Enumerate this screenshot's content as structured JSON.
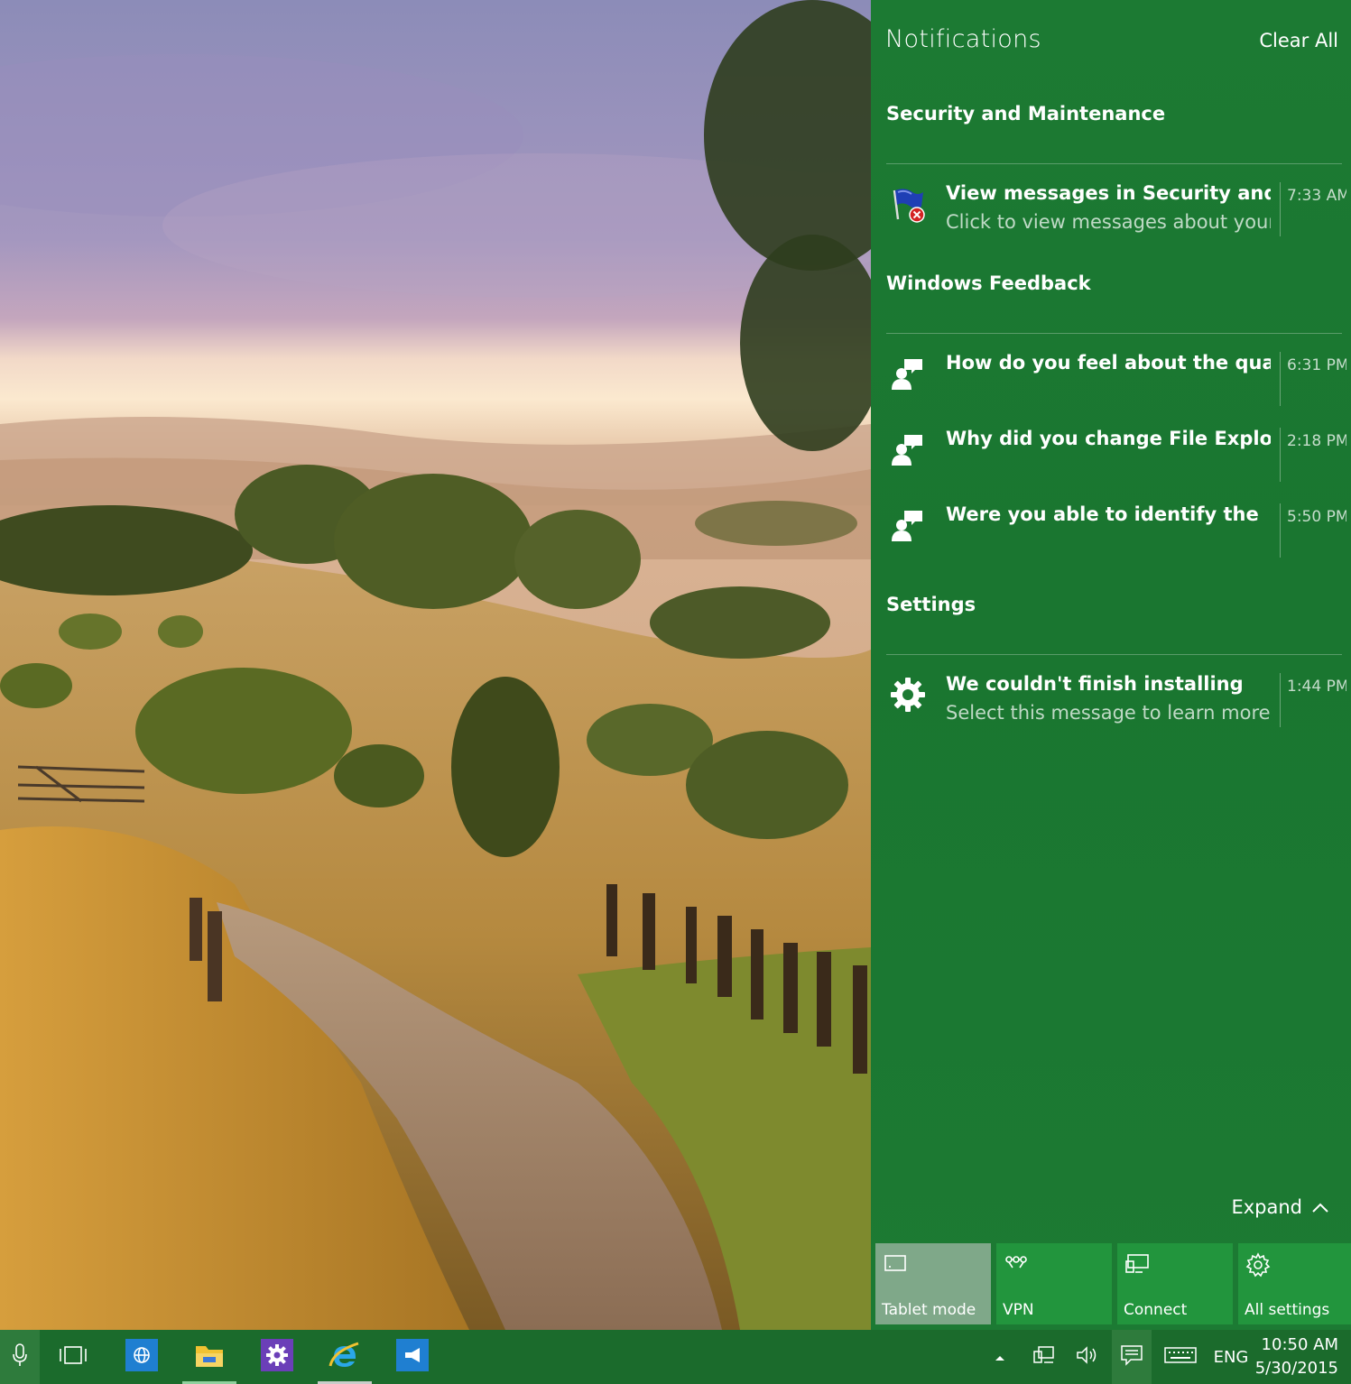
{
  "action_center": {
    "title": "Notifications",
    "clear_all": "Clear All",
    "groups": [
      {
        "title": "Security and Maintenance",
        "notifications": [
          {
            "title": "View messages in Security and",
            "body": "Click to view messages about your",
            "time": "7:33 AM",
            "icon": "security-flag-icon"
          }
        ]
      },
      {
        "title": "Windows Feedback",
        "notifications": [
          {
            "title": "How do you feel about the quality",
            "time": "6:31 PM",
            "icon": "feedback-icon"
          },
          {
            "title": "Why did you change File Explorer",
            "time": "2:18 PM",
            "icon": "feedback-icon"
          },
          {
            "title": "Were you able to identify the",
            "time": "5:50 PM",
            "icon": "feedback-icon"
          }
        ]
      },
      {
        "title": "Settings",
        "notifications": [
          {
            "title": "We couldn't finish installing",
            "body": "Select this message to learn more.",
            "time": "1:44 PM",
            "icon": "gear-icon"
          }
        ]
      }
    ],
    "expand_label": "Expand",
    "quick_actions": [
      {
        "label": "Tablet mode",
        "icon": "tablet-mode-icon",
        "active": true
      },
      {
        "label": "VPN",
        "icon": "vpn-icon",
        "active": false
      },
      {
        "label": "Connect",
        "icon": "connect-icon",
        "active": false
      },
      {
        "label": "All settings",
        "icon": "settings-icon",
        "active": false
      }
    ]
  },
  "taskbar": {
    "apps": [
      "microphone-icon",
      "task-view-icon",
      "globe-app-icon",
      "file-explorer-icon",
      "settings-app-icon",
      "internet-explorer-icon",
      "feedback-app-icon"
    ],
    "language": "ENG",
    "time": "10:50 AM",
    "date": "5/30/2015"
  },
  "colors": {
    "accent": "#1c7a33",
    "tile": "#22953d",
    "tile_active": "#7fa889",
    "taskbar": "#1b6b2c"
  }
}
